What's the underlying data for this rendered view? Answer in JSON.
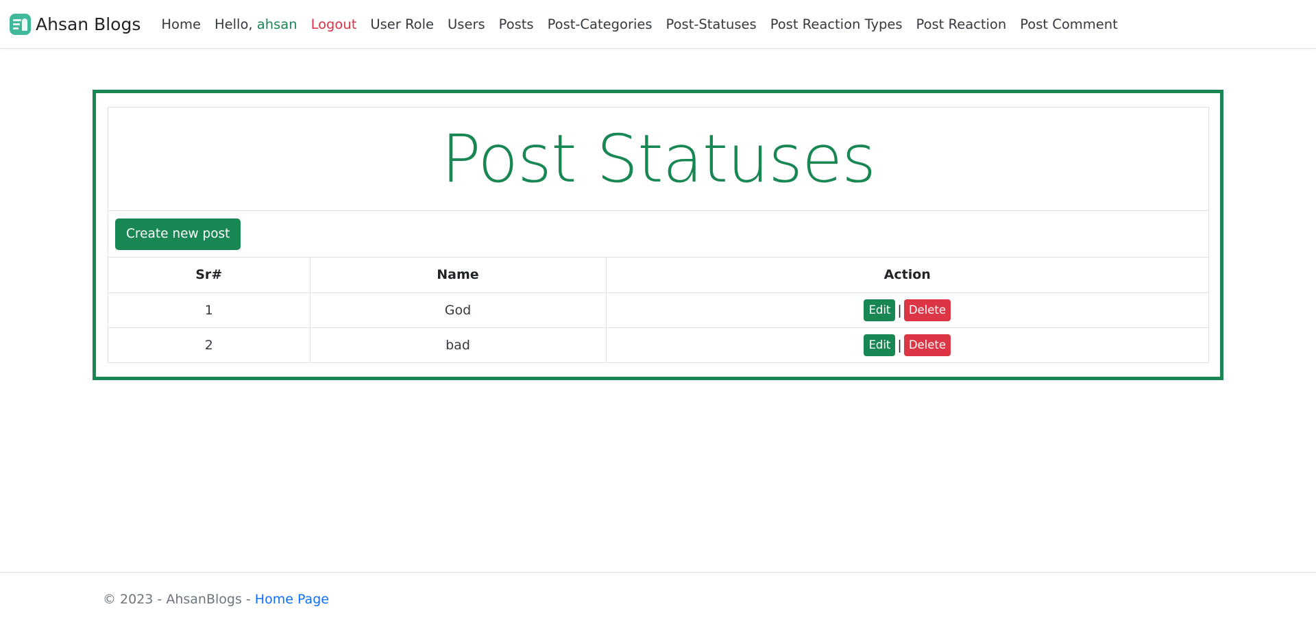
{
  "navbar": {
    "brand": "Ahsan Blogs",
    "items": [
      {
        "label": "Home"
      },
      {
        "label": "Hello, ",
        "user": "ahsan"
      },
      {
        "label": "Logout"
      },
      {
        "label": "User Role"
      },
      {
        "label": "Users"
      },
      {
        "label": "Posts"
      },
      {
        "label": "Post-Categories"
      },
      {
        "label": "Post-Statuses"
      },
      {
        "label": "Post Reaction Types"
      },
      {
        "label": "Post Reaction"
      },
      {
        "label": "Post Comment"
      }
    ]
  },
  "main": {
    "title": "Post Statuses",
    "create_button": "Create new post",
    "table": {
      "headers": [
        "Sr#",
        "Name",
        "Action"
      ],
      "rows": [
        {
          "sr": "1",
          "name": "God",
          "edit": "Edit",
          "sep": "|",
          "delete": "Delete"
        },
        {
          "sr": "2",
          "name": "bad",
          "edit": "Edit",
          "sep": "|",
          "delete": "Delete"
        }
      ]
    }
  },
  "footer": {
    "text": "© 2023 - AhsanBlogs - ",
    "link": "Home Page"
  },
  "colors": {
    "primary_green": "#198754",
    "danger_red": "#dc3545",
    "link_blue": "#0d6efd"
  }
}
